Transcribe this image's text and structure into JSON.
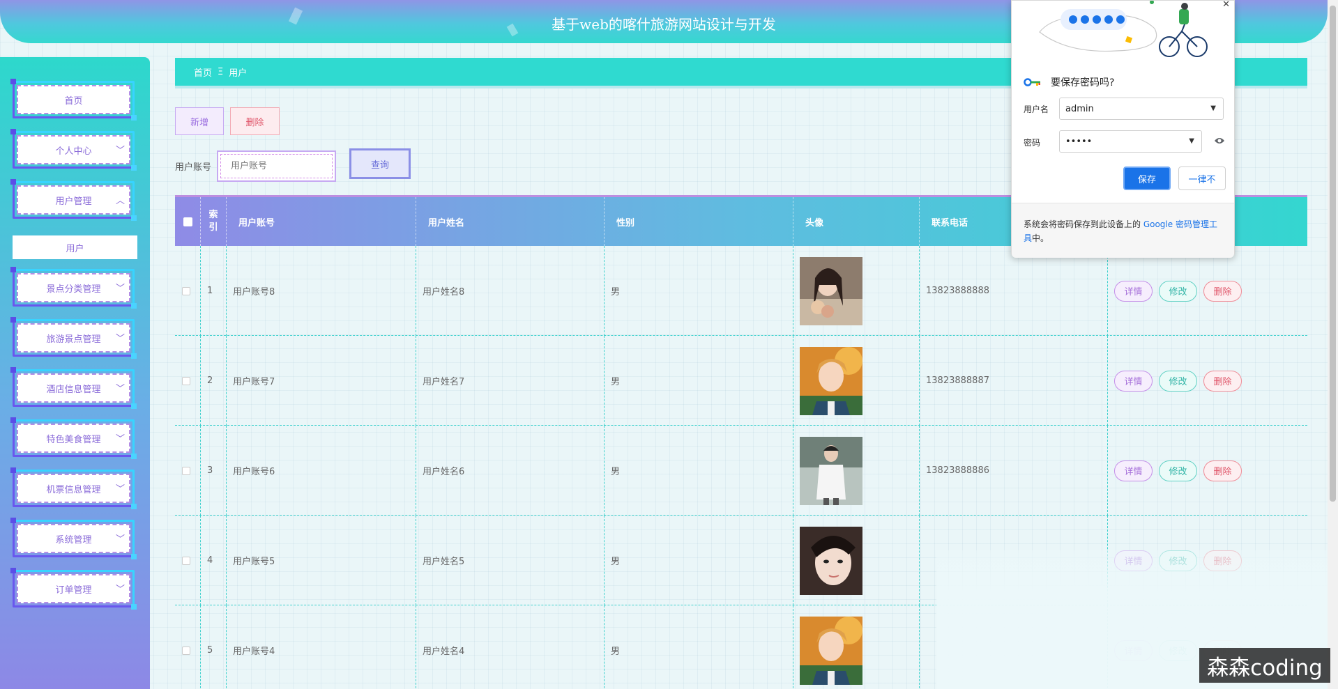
{
  "header": {
    "title": "基于web的喀什旅游网站设计与开发"
  },
  "sidebar": {
    "items": [
      {
        "label": "首页",
        "chevron": ""
      },
      {
        "label": "个人中心",
        "chevron": "chevron-down"
      },
      {
        "label": "用户管理",
        "chevron": "chevron-up"
      },
      {
        "label": "景点分类管理",
        "chevron": "chevron-down"
      },
      {
        "label": "旅游景点管理",
        "chevron": "chevron-down"
      },
      {
        "label": "酒店信息管理",
        "chevron": "chevron-down"
      },
      {
        "label": "特色美食管理",
        "chevron": "chevron-down"
      },
      {
        "label": "机票信息管理",
        "chevron": "chevron-down"
      },
      {
        "label": "系统管理",
        "chevron": "chevron-down"
      },
      {
        "label": "订单管理",
        "chevron": "chevron-down"
      }
    ],
    "submenu_label": "用户"
  },
  "breadcrumb": {
    "home": "首页",
    "separator": "Ξ",
    "current": "用户"
  },
  "toolbar": {
    "add_label": "新增",
    "delete_label": "删除"
  },
  "search": {
    "label": "用户账号",
    "placeholder": "用户账号",
    "value": "",
    "button_label": "查询"
  },
  "table": {
    "headers": [
      "索引",
      "用户账号",
      "用户姓名",
      "性别",
      "头像",
      "联系电话",
      ""
    ],
    "index_header_line1": "索",
    "index_header_line2": "引",
    "rows": [
      {
        "index": "1",
        "account": "用户账号8",
        "name": "用户姓名8",
        "gender": "男",
        "phone": "13823888888",
        "avatar": "girl-flowers"
      },
      {
        "index": "2",
        "account": "用户账号7",
        "name": "用户姓名7",
        "gender": "男",
        "phone": "13823888887",
        "avatar": "anime-boy"
      },
      {
        "index": "3",
        "account": "用户账号6",
        "name": "用户姓名6",
        "gender": "男",
        "phone": "13823888886",
        "avatar": "boy-white-shirt"
      },
      {
        "index": "4",
        "account": "用户账号5",
        "name": "用户姓名5",
        "gender": "男",
        "phone": "",
        "avatar": "girl-closeup"
      },
      {
        "index": "5",
        "account": "用户账号4",
        "name": "用户姓名4",
        "gender": "男",
        "phone": "",
        "avatar": "anime-boy"
      }
    ],
    "actions": {
      "detail": "详情",
      "edit": "修改",
      "delete": "删除"
    }
  },
  "password_popup": {
    "title": "要保存密码吗?",
    "username_label": "用户名",
    "username_value": "admin",
    "password_label": "密码",
    "password_value": "•••••",
    "save_label": "保存",
    "never_label": "一律不",
    "footer_text_pre": "系统会将密码保存到此设备上的 ",
    "footer_link": "Google 密码管理工具",
    "footer_text_post": "中。"
  },
  "watermark": "森森coding",
  "colors": {
    "accent_teal": "#2fdad0",
    "accent_purple": "#8f8be6",
    "primary_blue": "#1a73e8",
    "danger": "#e0566a"
  }
}
